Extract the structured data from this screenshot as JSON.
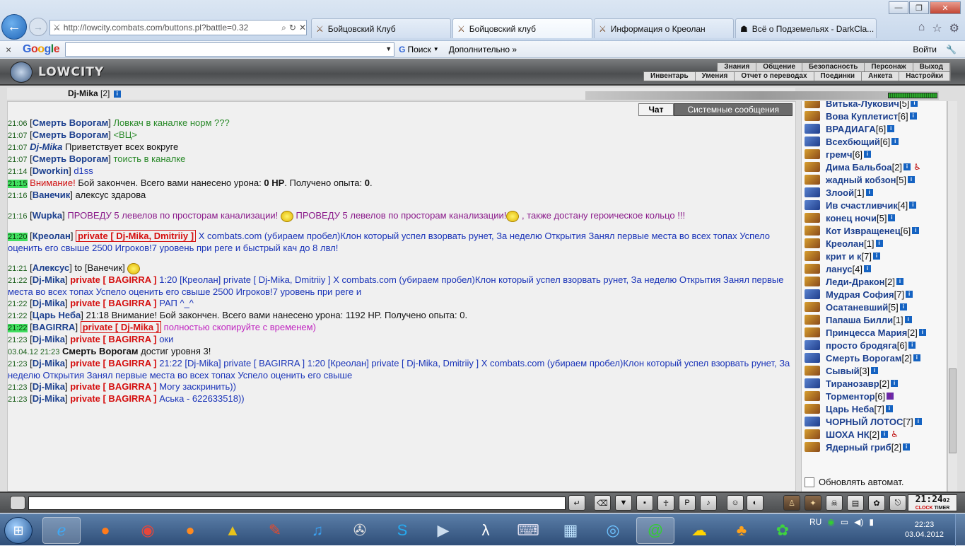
{
  "browser": {
    "url": "http://lowcity.combats.com/buttons.pl?battle=0.32",
    "tabs": [
      {
        "label": "Бойцовский Клуб",
        "active": false
      },
      {
        "label": "Бойцовский клуб",
        "active": true
      },
      {
        "label": "Информация о Креолан",
        "active": false
      },
      {
        "label": "Всё о Подземельях - DarkCla...",
        "active": false
      }
    ],
    "controls": {
      "minimize": "—",
      "restore": "❐",
      "close": "✕"
    }
  },
  "google_bar": {
    "logo": "Google",
    "search_value": "",
    "search_button": "Поиск",
    "more_label": "Дополнительно",
    "login_label": "Войти"
  },
  "game": {
    "logo_text": "LOWCITY",
    "menu_top": [
      "Знания",
      "Общение",
      "Безопасность",
      "Персонаж",
      "Выход"
    ],
    "menu_bottom": [
      "Инвентарь",
      "Умения",
      "Отчет о переводах",
      "Поединки",
      "Анкета",
      "Настройки"
    ],
    "user": {
      "name": "Dj-Mika",
      "level": "[2]"
    },
    "chat_tabs": {
      "chat": "Чат",
      "system": "Системные сообщения"
    },
    "auto_refresh_label": "Обновлять автомат.",
    "clock": {
      "time": "21:24",
      "seconds": "02",
      "label1": "CLOCK",
      "label2": "TIMER"
    },
    "chat_lines": [
      {
        "time": "21:06",
        "hl": false,
        "nick": "Смерть Ворогам",
        "text": "Ловкач в каналке норм ???",
        "text_class": "green"
      },
      {
        "time": "21:07",
        "hl": false,
        "nick": "Смерть Ворогам",
        "text": "<ВЦ>",
        "text_class": "green"
      },
      {
        "time": "21:07",
        "hl": false,
        "nick": "Dj-Mika",
        "text": "Приветствует всех вокруге",
        "text_class": "",
        "emote": true
      },
      {
        "time": "21:07",
        "hl": false,
        "nick": "Смерть Ворогам",
        "text": "тоисть в каналке",
        "text_class": "green"
      },
      {
        "time": "21:14",
        "hl": false,
        "nick": "Dworkin",
        "text": "d1ss",
        "text_class": "blue"
      },
      {
        "time": "21:15",
        "hl": true,
        "system": true,
        "warn": "Внимание!",
        "text": "Бой закончен. Всего вами нанесено урона:",
        "dmg": "0 HP",
        "text2": ". Получено опыта:",
        "exp": "0",
        "text3": "."
      },
      {
        "time": "21:16",
        "hl": false,
        "nick": "Ванечик",
        "text": "алексус здарова",
        "text_class": ""
      },
      {
        "time": "21:16",
        "hl": false,
        "nick": "Wupka",
        "text": "ПРОВЕДУ 5 левелов по просторам канализации!",
        "text_b": "ПРОВЕДУ 5 левелов по просторам канализации!",
        "text_c": ", также достану героическое кольцо !!!",
        "text_class": "purple",
        "smileys": 2,
        "gap_before": true
      },
      {
        "time": "21:20",
        "hl": true,
        "nick": "Креолан",
        "priv": "private [ Dj-Mika, Dmitriiy ]",
        "text": "X combats.com (убираем пробел)Клон который успел взорвать рунет, За неделю Открытия Занял первые места во всех топах Успело оценить его свыше 2500 Игроков!7 уровень при реге и быстрый кач до 8 лвл!",
        "text_class": "blue",
        "gap_before": true
      },
      {
        "time": "21:21",
        "hl": false,
        "nick": "Алексус",
        "to": "to [Ванечик]",
        "text_class": "",
        "smileys": 1,
        "gap_before": true
      },
      {
        "time": "21:22",
        "hl": false,
        "nick": "Dj-Mika",
        "priv": "private [ BAGIRRA ]",
        "text": "1:20 [Креолан] private [ Dj-Mika, Dmitriiy ] X combats.com (убираем пробел)Клон который успел взорвать рунет, За неделю Открытия Занял первые места во всех топах Успело оценить его свыше 2500 Игроков!7 уровень при реге и",
        "text_class": "blue"
      },
      {
        "time": "21:22",
        "hl": false,
        "nick": "Dj-Mika",
        "priv": "private [ BAGIRRA ]",
        "text": "РАП ^_^",
        "text_class": "blue"
      },
      {
        "time": "21:22",
        "hl": false,
        "nick": "Царь Неба",
        "text": "21:18 Внимание! Бой закончен. Всего вами нанесено урона: 1192 HP. Получено опыта: 0.",
        "text_class": ""
      },
      {
        "time": "21:22",
        "hl": true,
        "nick": "BAGIRRA",
        "priv": "private [ Dj-Mika ]",
        "text": "полностью скопируйте с временем)",
        "text_class": "magenta"
      },
      {
        "time": "21:23",
        "hl": false,
        "nick": "Dj-Mika",
        "priv": "private [ BAGIRRA ]",
        "text": "оки",
        "text_class": "blue"
      },
      {
        "time": "03.04.12 21:23",
        "hl": false,
        "level_up": true,
        "nick": "Смерть Ворогам",
        "text": "достиг уровня 3!"
      },
      {
        "time": "21:23",
        "hl": false,
        "nick": "Dj-Mika",
        "priv": "private [ BAGIRRA ]",
        "text": "21:22 [Dj-Mika] private [ BAGIRRA ] 1:20 [Креолан] private [ Dj-Mika, Dmitriiy ] X combats.com (убираем пробел)Клон который успел взорвать рунет, За неделю Открытия Занял первые места во всех топах Успело оценить его свыше",
        "text_class": "blue"
      },
      {
        "time": "21:23",
        "hl": false,
        "nick": "Dj-Mika",
        "priv": "private [ BAGIRRA ]",
        "text": "Могу заскринить))",
        "text_class": "blue"
      },
      {
        "time": "21:23",
        "hl": false,
        "nick": "Dj-Mika",
        "priv": "private [ BAGIRRA ]",
        "text": "Аська - 622633518))",
        "text_class": "blue"
      }
    ],
    "online": [
      {
        "name": "Витька-Лукович",
        "level": "[5]",
        "icon": "orange"
      },
      {
        "name": "Вова Куплетист",
        "level": "[6]",
        "icon": "orange"
      },
      {
        "name": "ВРАДИАГА",
        "level": "[6]",
        "icon": "blue"
      },
      {
        "name": "Всехбющий",
        "level": "[6]",
        "icon": "blue"
      },
      {
        "name": "гремч",
        "level": "[6]",
        "icon": "orange"
      },
      {
        "name": "Дима Бальбоа",
        "level": "[2]",
        "icon": "orange",
        "injured": true
      },
      {
        "name": "жадный кобзон",
        "level": "[5]",
        "icon": "orange"
      },
      {
        "name": "Злоой",
        "level": "[1]",
        "icon": "blue"
      },
      {
        "name": "Ив счастливчик",
        "level": "[4]",
        "icon": "blue"
      },
      {
        "name": "конец ночи",
        "level": "[5]",
        "icon": "orange"
      },
      {
        "name": "Кот Извращенец",
        "level": "[6]",
        "icon": "orange"
      },
      {
        "name": "Креолан",
        "level": "[1]",
        "icon": "orange"
      },
      {
        "name": "крит и к",
        "level": "[7]",
        "icon": "orange"
      },
      {
        "name": "ланус",
        "level": "[4]",
        "icon": "orange"
      },
      {
        "name": "Леди-Дракон",
        "level": "[2]",
        "icon": "orange"
      },
      {
        "name": "Мудрая София",
        "level": "[7]",
        "icon": "blue"
      },
      {
        "name": "Осатаневший",
        "level": "[5]",
        "icon": "orange"
      },
      {
        "name": "Папаша Билли",
        "level": "[1]",
        "icon": "orange"
      },
      {
        "name": "Принцесса Мария",
        "level": "[2]",
        "icon": "orange"
      },
      {
        "name": "просто бродяга",
        "level": "[6]",
        "icon": "blue"
      },
      {
        "name": "Смерть Ворогам",
        "level": "[2]",
        "icon": "blue"
      },
      {
        "name": "Сывый",
        "level": "[3]",
        "icon": "orange"
      },
      {
        "name": "Тиранозавр",
        "level": "[2]",
        "icon": "blue"
      },
      {
        "name": "Торментор",
        "level": "[6]",
        "icon": "orange"
      },
      {
        "name": "Царь Неба",
        "level": "[7]",
        "icon": "orange"
      },
      {
        "name": "ЧОРНЫЙ ЛОТОС",
        "level": "[7]",
        "icon": "blue"
      },
      {
        "name": "ШОХА НК",
        "level": "[2]",
        "icon": "orange",
        "injured": true
      },
      {
        "name": "Ядерный гриб",
        "level": "[2]",
        "icon": "orange"
      }
    ]
  },
  "taskbar": {
    "lang": "RU",
    "time": "22:23",
    "date": "03.04.2012"
  }
}
